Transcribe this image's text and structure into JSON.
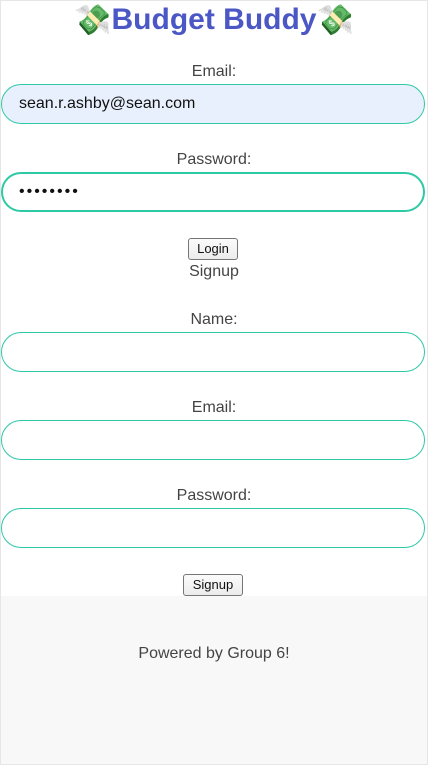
{
  "header": {
    "title": "Budget Buddy",
    "icon_left": "💸",
    "icon_right": "💸",
    "title_color": "#4b57c4"
  },
  "login": {
    "email_label": "Email:",
    "email_value": "sean.r.ashby@sean.com",
    "password_label": "Password:",
    "password_value": "password",
    "submit_label": "Login"
  },
  "signup": {
    "heading": "Signup",
    "name_label": "Name:",
    "name_value": "",
    "email_label": "Email:",
    "email_value": "",
    "password_label": "Password:",
    "password_value": "",
    "submit_label": "Signup"
  },
  "footer": {
    "text": "Powered by Group 6!"
  },
  "colors": {
    "input_border": "#2ec9a6",
    "autofill_bg": "#e8f0fe",
    "footer_bg": "#f8f8f8"
  }
}
